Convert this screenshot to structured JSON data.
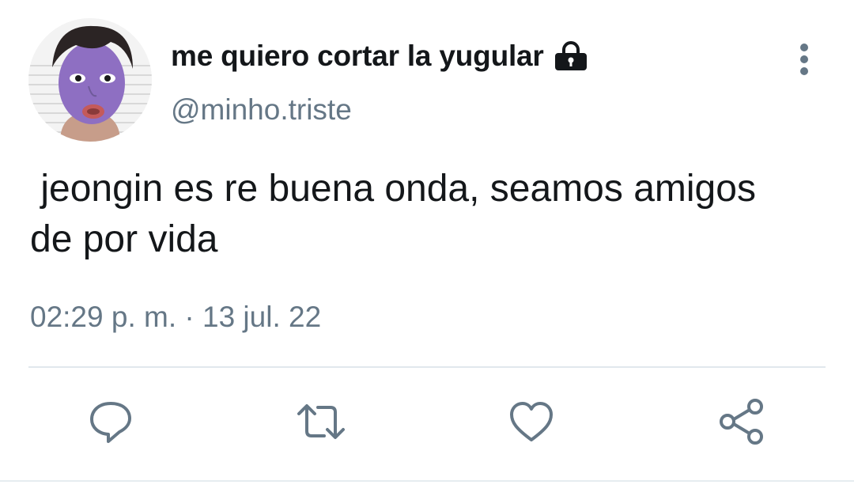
{
  "user": {
    "display_name": "me quiero cortar la yugular",
    "handle": "@minho.triste",
    "protected_icon": "lock-icon"
  },
  "tweet": {
    "text": " jeongin es re buena onda, seamos amigos de por vida",
    "timestamp": "02:29 p. m. · 13 jul. 22"
  },
  "actions": [
    "reply-icon",
    "retweet-icon",
    "like-icon",
    "share-icon"
  ],
  "colors": {
    "text_primary": "#14171a",
    "text_secondary": "#657786",
    "icon": "#657786",
    "divider": "#e1e8ed"
  }
}
